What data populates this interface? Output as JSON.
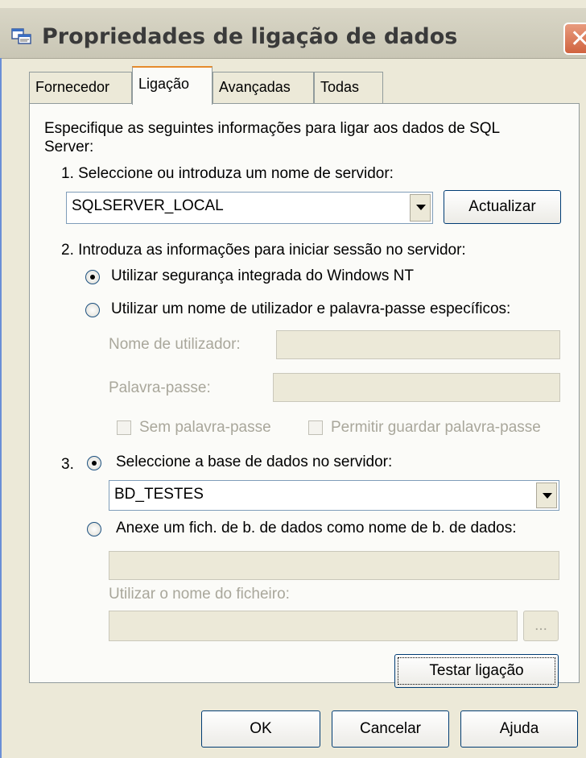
{
  "window": {
    "title": "Propriedades de ligação de dados"
  },
  "tabs": [
    {
      "label": "Fornecedor"
    },
    {
      "label": "Ligação"
    },
    {
      "label": "Avançadas"
    },
    {
      "label": "Todas"
    }
  ],
  "connection": {
    "intro": "Especifique as seguintes informações para ligar aos dados de SQL",
    "intro_line2": "Server:",
    "step1_label": "1. Seleccione ou introduza um nome de servidor:",
    "server_value": "SQLSERVER_LOCAL",
    "refresh_button": "Actualizar",
    "step2_label": "2. Introduza as informações para iniciar sessão no servidor:",
    "radio_integrated": "Utilizar segurança integrada do Windows NT",
    "radio_userpass": "Utilizar um nome de utilizador e palavra-passe específicos:",
    "username_label": "Nome de utilizador:",
    "password_label": "Palavra-passe:",
    "blank_password": "Sem palavra-passe",
    "allow_save_password": "Permitir guardar palavra-passe",
    "step3_number": "3.",
    "radio_select_db": "Seleccione a base de dados no servidor:",
    "database_value": "BD_TESTES",
    "radio_attach": "Anexe um fich. de b. de dados como nome de b. de dados:",
    "filename_label": "Utilizar o nome do ficheiro:",
    "browse_button": "...",
    "test_button": "Testar ligação"
  },
  "footer": {
    "ok": "OK",
    "cancel": "Cancelar",
    "help": "Ajuda"
  },
  "icons": {
    "title": "data-link-icon",
    "close": "close-icon"
  }
}
